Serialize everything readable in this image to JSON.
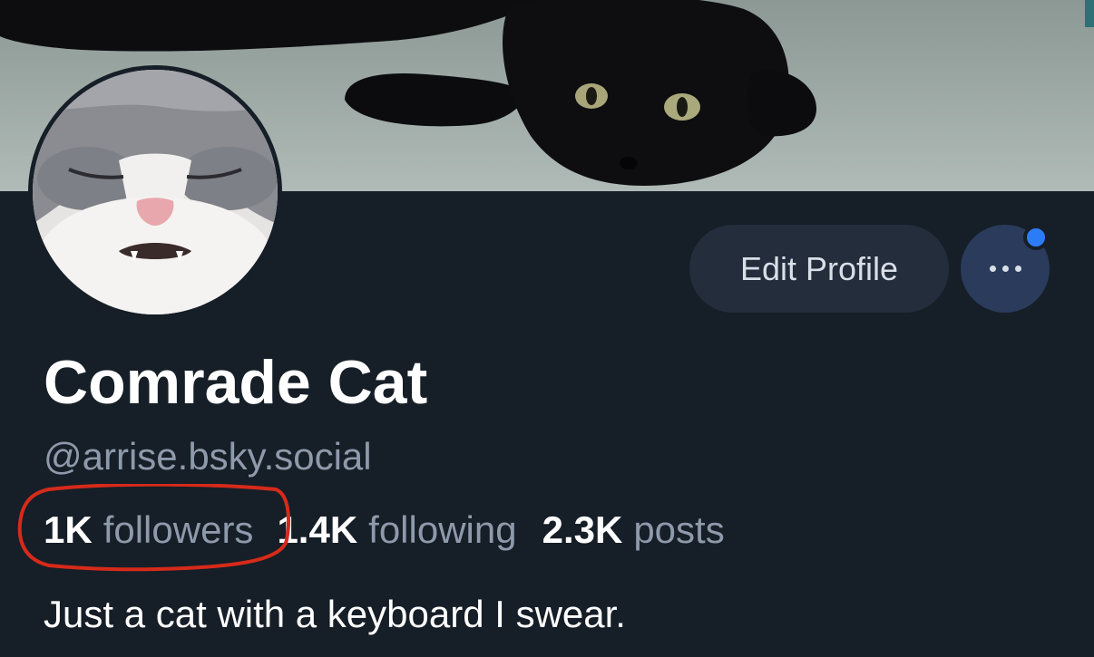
{
  "profile": {
    "display_name": "Comrade Cat",
    "handle": "@arrise.bsky.social",
    "bio": "Just a cat with a keyboard I swear."
  },
  "actions": {
    "edit_label": "Edit Profile"
  },
  "stats": {
    "followers_count": "1K",
    "followers_label": "followers",
    "following_count": "1.4K",
    "following_label": "following",
    "posts_count": "2.3K",
    "posts_label": "posts"
  },
  "colors": {
    "background": "#161e27",
    "accent": "#2d7cf7",
    "annotation": "#d62a1a"
  }
}
